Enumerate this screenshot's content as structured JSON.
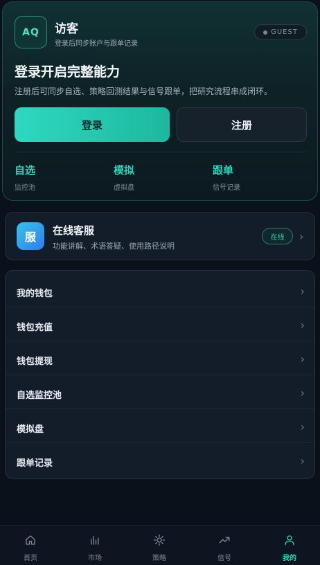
{
  "profile": {
    "avatar_text": "AQ",
    "name": "访客",
    "subtitle": "登录后同步账户与跟单记录",
    "badge": "GUEST",
    "headline": "登录开启完整能力",
    "description": "注册后可同步自选、策略回测结果与信号跟单，把研究流程串成闭环。",
    "login_label": "登录",
    "register_label": "注册",
    "quick_links": [
      {
        "title": "自选",
        "subtitle": "监控池"
      },
      {
        "title": "模拟",
        "subtitle": "虚拟盘"
      },
      {
        "title": "跟单",
        "subtitle": "信号记录"
      }
    ]
  },
  "service": {
    "icon_text": "服",
    "title": "在线客服",
    "subtitle": "功能讲解、术语答疑、使用路径说明",
    "status": "在线"
  },
  "menu": {
    "items": [
      {
        "label": "我的钱包"
      },
      {
        "label": "钱包充值"
      },
      {
        "label": "钱包提现"
      },
      {
        "label": "自选监控池"
      },
      {
        "label": "模拟盘"
      },
      {
        "label": "跟单记录"
      }
    ]
  },
  "tabbar": {
    "tabs": [
      {
        "label": "首页",
        "icon": "home-icon"
      },
      {
        "label": "市场",
        "icon": "bar-chart-icon"
      },
      {
        "label": "策略",
        "icon": "sun-icon"
      },
      {
        "label": "信号",
        "icon": "trend-icon"
      },
      {
        "label": "我的",
        "icon": "user-icon"
      }
    ],
    "active_index": 4
  },
  "colors": {
    "accent": "#2ed3bb",
    "background": "#0b111b",
    "card": "#131c29"
  }
}
